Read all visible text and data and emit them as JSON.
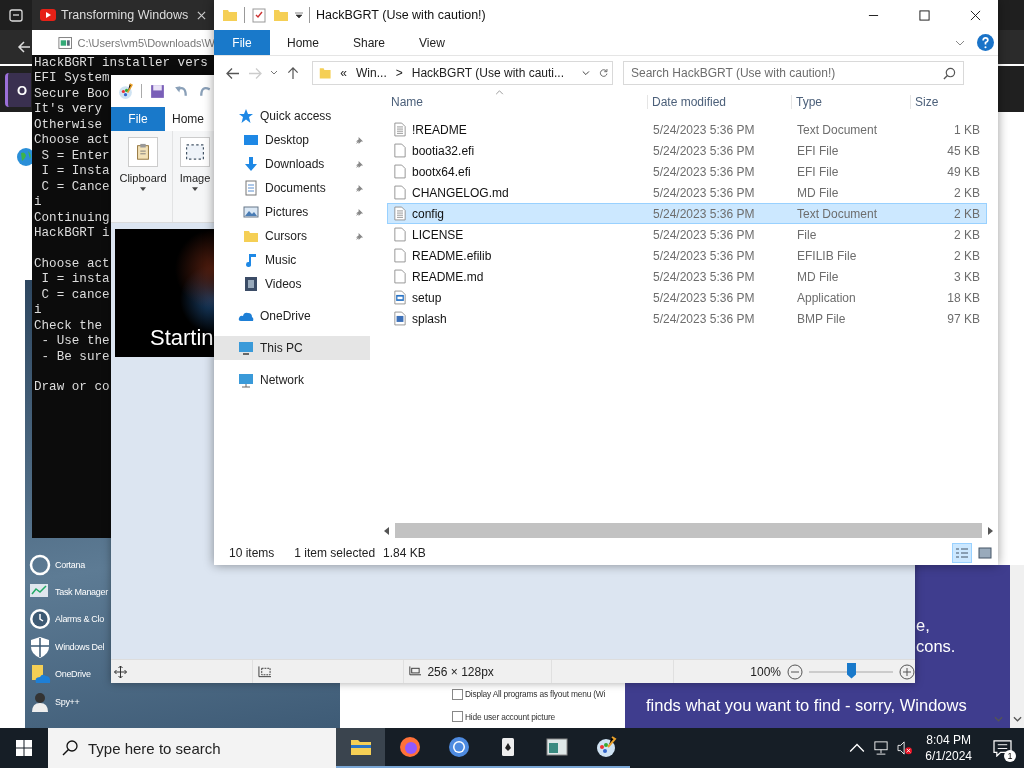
{
  "browser": {
    "tab_title": "Transforming Windows",
    "side_button": "O",
    "article_lines": [
      {
        "text": "e,",
        "kind": "tail"
      },
      {
        "text": "cons.",
        "kind": "tail"
      },
      {
        "text": "finds what you want to find - sorry, Windows",
        "kind": "line"
      }
    ]
  },
  "start_menu": {
    "items": [
      {
        "label": "Cortana",
        "kind": "ring"
      },
      {
        "label": "Task Manager",
        "kind": "chart"
      },
      {
        "label": "Alarms & Clo",
        "kind": "clock"
      },
      {
        "label": "Windows Del",
        "kind": "shield"
      },
      {
        "label": "OneDrive",
        "kind": "cloud"
      },
      {
        "label": "Spy++",
        "kind": "spy"
      }
    ]
  },
  "settings_panel": {
    "options": [
      {
        "label": "Display All programs as flyout menu (Wi",
        "checked": false
      },
      {
        "label": "Hide user account picture",
        "checked": false
      }
    ]
  },
  "console": {
    "title": "C:\\Users\\vm5\\Downloads\\W",
    "blocks": [
      [
        "HackBGRT installer vers",
        "EFI System",
        "Secure Boo",
        "It's very",
        "Otherwise",
        "Choose act",
        " S = Enter",
        " I = Insta",
        " C = Cance",
        "i",
        "Continuing",
        "HackBGRT i"
      ],
      [
        "Choose act",
        " I = insta",
        " C = cance",
        "i",
        "Check the",
        " - Use the",
        " - Be sure"
      ],
      [
        "Draw or co"
      ]
    ]
  },
  "paint": {
    "tabs": [
      {
        "label": "File",
        "selected": true
      },
      {
        "label": "Home",
        "selected": false
      }
    ],
    "groups": [
      {
        "label": "Clipboard",
        "kind": "clipboard"
      },
      {
        "label": "Image",
        "kind": "select"
      }
    ],
    "canvas_text": "Startin",
    "status": {
      "size": "256 × 128px",
      "zoom": "100%",
      "level": 0.5
    }
  },
  "explorer": {
    "title": "HackBGRT (Use with caution!)",
    "tabs": [
      {
        "label": "File",
        "selected": true
      },
      {
        "label": "Home",
        "selected": false
      },
      {
        "label": "Share",
        "selected": false
      },
      {
        "label": "View",
        "selected": false
      }
    ],
    "address": {
      "prefix": "«",
      "parent": "Win...",
      "separator": ">",
      "current": "HackBGRT (Use with cauti..."
    },
    "search": {
      "placeholder": "Search HackBGRT (Use with caution!)"
    },
    "nav": [
      {
        "label": "Quick access",
        "kind": "star",
        "pinned": false,
        "selected": false,
        "group": true
      },
      {
        "label": "Desktop",
        "kind": "desktop",
        "pinned": true,
        "selected": false,
        "group": false
      },
      {
        "label": "Downloads",
        "kind": "download",
        "pinned": true,
        "selected": false,
        "group": false
      },
      {
        "label": "Documents",
        "kind": "document",
        "pinned": true,
        "selected": false,
        "group": false
      },
      {
        "label": "Pictures",
        "kind": "pictures",
        "pinned": true,
        "selected": false,
        "group": false
      },
      {
        "label": "Cursors",
        "kind": "folder",
        "pinned": true,
        "selected": false,
        "group": false
      },
      {
        "label": "Music",
        "kind": "music",
        "pinned": false,
        "selected": false,
        "group": false
      },
      {
        "label": "Videos",
        "kind": "video",
        "pinned": false,
        "selected": false,
        "group": false
      },
      {
        "label": "OneDrive",
        "kind": "cloud",
        "pinned": false,
        "selected": false,
        "group": true
      },
      {
        "label": "This PC",
        "kind": "pc",
        "pinned": false,
        "selected": true,
        "group": true
      },
      {
        "label": "Network",
        "kind": "network",
        "pinned": false,
        "selected": false,
        "group": true
      }
    ],
    "columns": [
      "Name",
      "Date modified",
      "Type",
      "Size"
    ],
    "rows": [
      {
        "name": "!README",
        "date": "5/24/2023 5:36 PM",
        "type": "Text Document",
        "size": "1 KB",
        "kind": "text",
        "selected": false
      },
      {
        "name": "bootia32.efi",
        "date": "5/24/2023 5:36 PM",
        "type": "EFI File",
        "size": "45 KB",
        "kind": "blank",
        "selected": false
      },
      {
        "name": "bootx64.efi",
        "date": "5/24/2023 5:36 PM",
        "type": "EFI File",
        "size": "49 KB",
        "kind": "blank",
        "selected": false
      },
      {
        "name": "CHANGELOG.md",
        "date": "5/24/2023 5:36 PM",
        "type": "MD File",
        "size": "2 KB",
        "kind": "blank",
        "selected": false
      },
      {
        "name": "config",
        "date": "5/24/2023 5:36 PM",
        "type": "Text Document",
        "size": "2 KB",
        "kind": "text",
        "selected": true
      },
      {
        "name": "LICENSE",
        "date": "5/24/2023 5:36 PM",
        "type": "File",
        "size": "2 KB",
        "kind": "blank",
        "selected": false
      },
      {
        "name": "README.efilib",
        "date": "5/24/2023 5:36 PM",
        "type": "EFILIB File",
        "size": "2 KB",
        "kind": "blank",
        "selected": false
      },
      {
        "name": "README.md",
        "date": "5/24/2023 5:36 PM",
        "type": "MD File",
        "size": "3 KB",
        "kind": "blank",
        "selected": false
      },
      {
        "name": "setup",
        "date": "5/24/2023 5:36 PM",
        "type": "Application",
        "size": "18 KB",
        "kind": "app",
        "selected": false
      },
      {
        "name": "splash",
        "date": "5/24/2023 5:36 PM",
        "type": "BMP File",
        "size": "97 KB",
        "kind": "image",
        "selected": false
      }
    ],
    "status": {
      "count": "10 items",
      "selection": "1 item selected",
      "selection_size": "1.84 KB"
    },
    "views": [
      {
        "kind": "details",
        "selected": true
      },
      {
        "kind": "large",
        "selected": false
      }
    ]
  },
  "taskbar": {
    "search_placeholder": "Type here to search",
    "apps": [
      {
        "kind": "explorer",
        "selected": true
      },
      {
        "kind": "firefox",
        "selected": false
      },
      {
        "kind": "chromium",
        "selected": false
      },
      {
        "kind": "cards",
        "selected": false
      },
      {
        "kind": "window",
        "selected": false
      },
      {
        "kind": "paint",
        "selected": false
      }
    ],
    "time": "8:04 PM",
    "date": "6/1/2024",
    "notifications": "1"
  }
}
